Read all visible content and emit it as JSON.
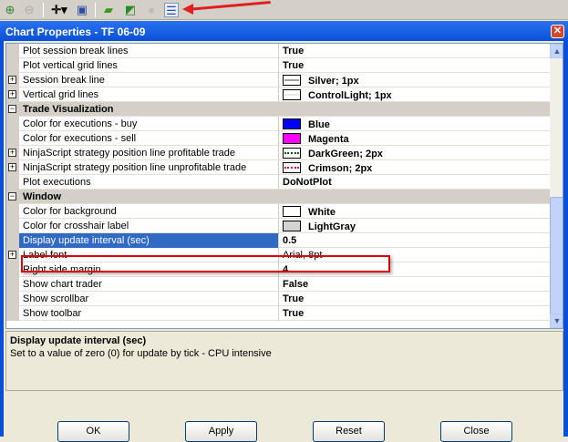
{
  "toolbar": {
    "icons": [
      "zoom-in-icon",
      "zoom-out-icon",
      "crosshair-icon",
      "zoom-box-icon",
      "money-icon",
      "chart-icon",
      "dollar-icon",
      "properties-icon"
    ]
  },
  "window": {
    "title": "Chart Properties - TF 06-09"
  },
  "rows": [
    {
      "type": "prop",
      "name": "Plot session break lines",
      "value": "True"
    },
    {
      "type": "prop",
      "name": "Plot vertical grid lines",
      "value": "True"
    },
    {
      "type": "prop",
      "expand": true,
      "name": "Session break line",
      "value": "Silver; 1px",
      "swatch": "line",
      "color": "#a0a0a0"
    },
    {
      "type": "prop",
      "expand": true,
      "name": "Vertical grid lines",
      "value": "ControlLight; 1px",
      "swatch": "line",
      "color": "#e8e8e8"
    },
    {
      "type": "cat",
      "name": "Trade Visualization"
    },
    {
      "type": "prop",
      "name": "Color for executions - buy",
      "value": "Blue",
      "swatch": "fill",
      "color": "#0000ff"
    },
    {
      "type": "prop",
      "name": "Color for executions - sell",
      "value": "Magenta",
      "swatch": "fill",
      "color": "#ff00ff"
    },
    {
      "type": "prop",
      "expand": true,
      "name": "NinjaScript strategy position line profitable trade",
      "value": "DarkGreen; 2px",
      "swatch": "dot",
      "color": "#006400"
    },
    {
      "type": "prop",
      "expand": true,
      "name": "NinjaScript strategy position line unprofitable trade",
      "value": "Crimson; 2px",
      "swatch": "dot",
      "color": "#dc143c"
    },
    {
      "type": "prop",
      "name": "Plot executions",
      "value": "DoNotPlot"
    },
    {
      "type": "cat",
      "name": "Window"
    },
    {
      "type": "prop",
      "name": "Color for background",
      "value": "White",
      "swatch": "fill",
      "color": "#ffffff"
    },
    {
      "type": "prop",
      "name": "Color for crosshair label",
      "value": "LightGray",
      "swatch": "fill",
      "color": "#d3d3d3"
    },
    {
      "type": "prop",
      "name": "Display update interval (sec)",
      "value": "0.5",
      "selected": true
    },
    {
      "type": "prop",
      "expand": true,
      "name": "Label font",
      "value": "Arial, 8pt",
      "normal": true
    },
    {
      "type": "prop",
      "name": "Right side margin",
      "value": "4"
    },
    {
      "type": "prop",
      "name": "Show chart trader",
      "value": "False"
    },
    {
      "type": "prop",
      "name": "Show scrollbar",
      "value": "True"
    },
    {
      "type": "prop",
      "name": "Show toolbar",
      "value": "True"
    }
  ],
  "description": {
    "title": "Display update interval (sec)",
    "text": "Set to a value of zero (0) for update by tick - CPU intensive"
  },
  "buttons": {
    "ok": "OK",
    "apply": "Apply",
    "reset": "Reset",
    "close": "Close"
  }
}
